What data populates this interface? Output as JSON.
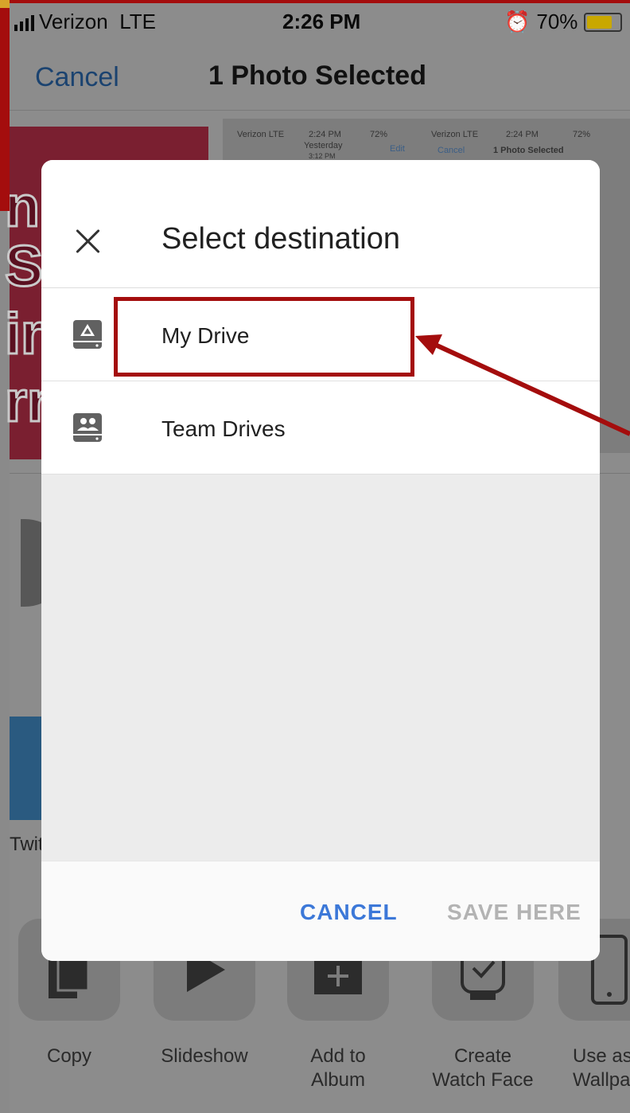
{
  "status_bar": {
    "carrier": "Verizon",
    "network": "LTE",
    "time": "2:26 PM",
    "battery_percent": "70%",
    "battery_level": 0.7
  },
  "nav": {
    "cancel_label": "Cancel",
    "title": "1 Photo Selected"
  },
  "background_thumbnail": {
    "mini_status_left": "Verizon LTE",
    "mini_time_left": "2:24 PM",
    "mini_battery_left": "72%",
    "mini_date": "Yesterday",
    "mini_date_time": "3:12 PM",
    "mini_edit": "Edit",
    "mini_status_right": "Verizon LTE",
    "mini_time_right": "2:24 PM",
    "mini_battery_right": "72%",
    "mini_cancel": "Cancel",
    "mini_title": "1 Photo Selected"
  },
  "share_row": {
    "partial_label": "Twit"
  },
  "actions": [
    {
      "label": "Copy",
      "icon": "copy-icon"
    },
    {
      "label": "Slideshow",
      "icon": "play-icon"
    },
    {
      "label": "Add to Album",
      "icon": "add-album-icon"
    },
    {
      "label": "Create\nWatch Face",
      "icon": "watch-icon"
    },
    {
      "label": "Use as\nWallpap",
      "icon": "phone-icon"
    }
  ],
  "dialog": {
    "title": "Select destination",
    "destinations": [
      {
        "label": "My Drive",
        "icon": "drive-icon"
      },
      {
        "label": "Team Drives",
        "icon": "team-drive-icon"
      }
    ],
    "cancel_label": "CANCEL",
    "save_label": "SAVE HERE"
  },
  "colors": {
    "annotation_red": "#a40d0d",
    "link_blue": "#3c78d8",
    "disabled_gray": "#b3b3b3"
  }
}
